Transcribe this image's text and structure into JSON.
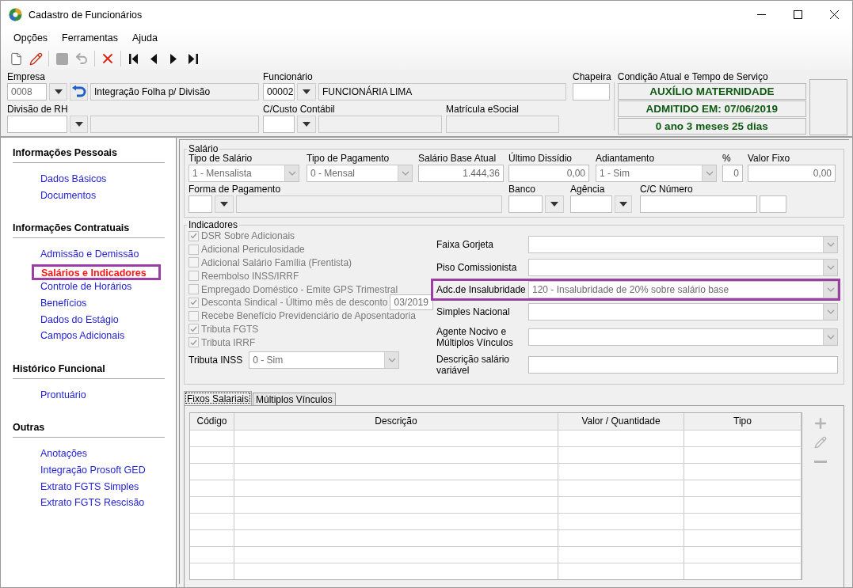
{
  "window": {
    "title": "Cadastro de Funcionários"
  },
  "menu": [
    {
      "label": "Opções"
    },
    {
      "label": "Ferramentas"
    },
    {
      "label": "Ajuda"
    }
  ],
  "toolbar": [
    {
      "kind": "new",
      "disabled": false
    },
    {
      "kind": "edit",
      "disabled": false
    },
    {
      "kind": "save",
      "disabled": true
    },
    {
      "kind": "undo",
      "disabled": true
    },
    {
      "kind": "delete",
      "disabled": false
    },
    {
      "kind": "first",
      "disabled": false
    },
    {
      "kind": "prev",
      "disabled": false
    },
    {
      "kind": "next",
      "disabled": false
    },
    {
      "kind": "last",
      "disabled": false
    }
  ],
  "header": {
    "empresa": {
      "label": "Empresa",
      "code": "0008",
      "code_disabled": true,
      "description": "Integração Folha p/ Divisão"
    },
    "funcionario": {
      "label": "Funcionário",
      "code": "00002",
      "name": "FUNCIONÁRIA LIMA"
    },
    "divisao": {
      "label": "Divisão de RH"
    },
    "ccusto": {
      "label": "C/Custo Contábil"
    },
    "matricula": {
      "label": "Matrícula eSocial"
    },
    "chapeira": {
      "label": "Chapeira"
    },
    "condicao": {
      "label": "Condição Atual e Tempo de Serviço",
      "lines": [
        "AUXÍLIO MATERNIDADE",
        "ADMITIDO EM: 07/06/2019",
        "0 ano 3 meses 25 dias"
      ]
    }
  },
  "sidebar": [
    {
      "title": "Informações Pessoais",
      "items": [
        {
          "label": "Dados Básicos",
          "selected": false
        },
        {
          "label": "Documentos",
          "selected": false
        }
      ]
    },
    {
      "title": "Informações Contratuais",
      "items": [
        {
          "label": "Admissão e Demissão",
          "selected": false
        },
        {
          "label": "Salários e Indicadores",
          "selected": true
        },
        {
          "label": "Controle de Horários",
          "selected": false
        },
        {
          "label": "Benefícios",
          "selected": false
        },
        {
          "label": "Dados do Estágio",
          "selected": false
        },
        {
          "label": "Campos Adicionais",
          "selected": false
        }
      ]
    },
    {
      "title": "Histórico Funcional",
      "items": [
        {
          "label": "Prontuário",
          "selected": false
        }
      ]
    },
    {
      "title": "Outras",
      "items": [
        {
          "label": "Anotações",
          "selected": false
        },
        {
          "label": "Integração Prosoft GED",
          "selected": false
        },
        {
          "label": "Extrato FGTS Simples",
          "selected": false
        },
        {
          "label": "Extrato FGTS Rescisão",
          "selected": false
        }
      ]
    }
  ],
  "salario": {
    "title": "Salário",
    "row1": [
      {
        "kind": "select",
        "label": "Tipo de Salário",
        "value": "1 - Mensalista"
      },
      {
        "kind": "select",
        "label": "Tipo de Pagamento",
        "value": "0 - Mensal"
      },
      {
        "kind": "number",
        "label": "Salário Base Atual",
        "value": "1.444,36"
      },
      {
        "kind": "number",
        "label": "Último Dissídio",
        "value": "0,00"
      },
      {
        "kind": "select",
        "label": "Adiantamento",
        "value": "1 - Sim"
      },
      {
        "kind": "number",
        "label": "%",
        "value": "0"
      },
      {
        "kind": "number",
        "label": "Valor Fixo",
        "value": "0,00"
      }
    ],
    "row2": [
      {
        "kind": "lookup",
        "label": "Forma de Pagamento"
      },
      {
        "kind": "lookup",
        "label": "Banco"
      },
      {
        "kind": "lookup",
        "label": "Agência"
      },
      {
        "kind": "pair",
        "label": "C/C Número"
      }
    ]
  },
  "indicadores": {
    "title": "Indicadores",
    "checks": [
      {
        "kind": "checkbox",
        "label": "DSR Sobre Adicionais",
        "checked": true,
        "disabled": true
      },
      {
        "kind": "checkbox",
        "label": "Adicional Periculosidade",
        "checked": false,
        "disabled": true
      },
      {
        "kind": "checkbox",
        "label": "Adicional Salário Família (Frentista)",
        "checked": false,
        "disabled": true
      },
      {
        "kind": "checkbox",
        "label": "Reembolso INSS/IRRF",
        "checked": false,
        "disabled": true
      },
      {
        "kind": "checkbox",
        "label": "Empregado Doméstico - Emite GPS Trimestral",
        "checked": false,
        "disabled": true
      },
      {
        "kind": "checkbox_date",
        "label": "Desconta Sindical - Último mês de desconto",
        "checked": true,
        "disabled": true,
        "value": "03/2019"
      },
      {
        "kind": "checkbox",
        "label": "Recebe Benefício Previdenciário de Aposentadoria",
        "checked": false,
        "disabled": true
      },
      {
        "kind": "checkbox",
        "label": "Tributa FGTS",
        "checked": true,
        "disabled": true
      },
      {
        "kind": "checkbox",
        "label": "Tributa IRRF",
        "checked": true,
        "disabled": true
      }
    ],
    "inss": {
      "label": "Tributa INSS",
      "value": "0 - Sim"
    },
    "fields": [
      {
        "kind": "select",
        "label": "Faixa Gorjeta",
        "highlighted": false
      },
      {
        "kind": "select",
        "label": "Piso Comissionista",
        "highlighted": false
      },
      {
        "kind": "select",
        "label": "Adc.de Insalubridade",
        "value": "120 - Insalubridade de 20% sobre salário base",
        "highlighted": true
      },
      {
        "kind": "select",
        "label": "Simples Nacional",
        "highlighted": false
      },
      {
        "kind": "select",
        "label": "Agente Nocivo e Múltiplos Vínculos",
        "highlighted": false
      },
      {
        "kind": "text",
        "label": "Descrição salário variável",
        "highlighted": false
      }
    ]
  },
  "tabs": [
    {
      "label": "Fixos Salariais",
      "selected": true
    },
    {
      "label": "Múltiplos Vínculos",
      "selected": false
    }
  ],
  "table": {
    "columns": [
      "Código",
      "Descrição",
      "Valor / Quantidade",
      "Tipo"
    ]
  },
  "grid_actions": [
    {
      "kind": "add",
      "disabled": true
    },
    {
      "kind": "edit",
      "disabled": true
    },
    {
      "kind": "remove",
      "disabled": true
    }
  ]
}
